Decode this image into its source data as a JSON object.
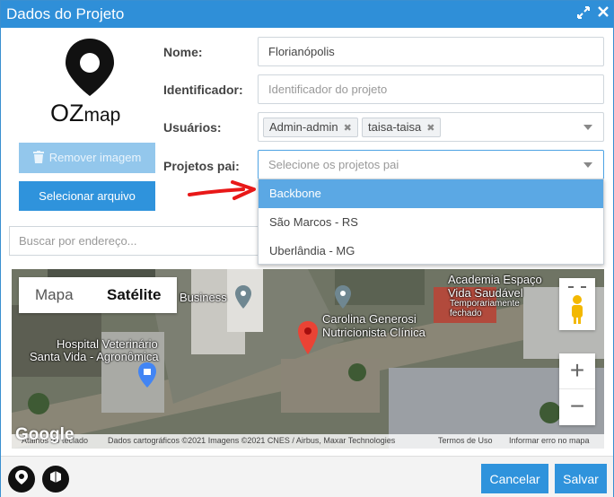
{
  "dialog": {
    "title": "Dados do Projeto",
    "maximize_icon": "expand-icon",
    "close_icon": "close-icon"
  },
  "logo": {
    "text_oz": "OZ",
    "text_map": "map"
  },
  "buttons": {
    "remove_image": "Remover imagem",
    "select_file": "Selecionar arquivo",
    "cancel": "Cancelar",
    "save": "Salvar"
  },
  "form": {
    "name_label": "Nome:",
    "name_value": "Florianópolis",
    "identifier_label": "Identificador:",
    "identifier_placeholder": "Identificador do projeto",
    "users_label": "Usuários:",
    "users": [
      "Admin-admin",
      "taisa-taisa"
    ],
    "parent_label": "Projetos pai:",
    "parent_placeholder": "Selecione os projetos pai",
    "parent_options": [
      "Backbone",
      "São Marcos - RS",
      "Uberlândia - MG"
    ],
    "highlighted_option": "Backbone"
  },
  "search": {
    "placeholder": "Buscar por endereço..."
  },
  "map": {
    "tabs": [
      "Mapa",
      "Satélite"
    ],
    "active_tab": "Satélite",
    "labels": {
      "academia": "Academia Espaço",
      "academia2": "Vida Saudável",
      "academia3": "Temporariamente",
      "academia4": "fechado",
      "business": "Business",
      "carolina": "Carolina Generosi",
      "carolina2": "Nutricionista Clínica",
      "hospital": "Hospital Veterinário",
      "hospital2": "Santa Vida - Agronômica"
    },
    "zoom_in": "+",
    "zoom_out": "−",
    "google": "Google",
    "attribution": {
      "shortcuts": "Atalhos do teclado",
      "data": "Dados cartográficos ©2021 Imagens ©2021 CNES / Airbus, Maxar Technologies",
      "terms": "Termos de Uso",
      "report": "Informar erro no mapa"
    }
  },
  "colors": {
    "primary": "#2f93dc",
    "titlebar": "#2f8fd8",
    "highlight": "#5ba8e4"
  }
}
